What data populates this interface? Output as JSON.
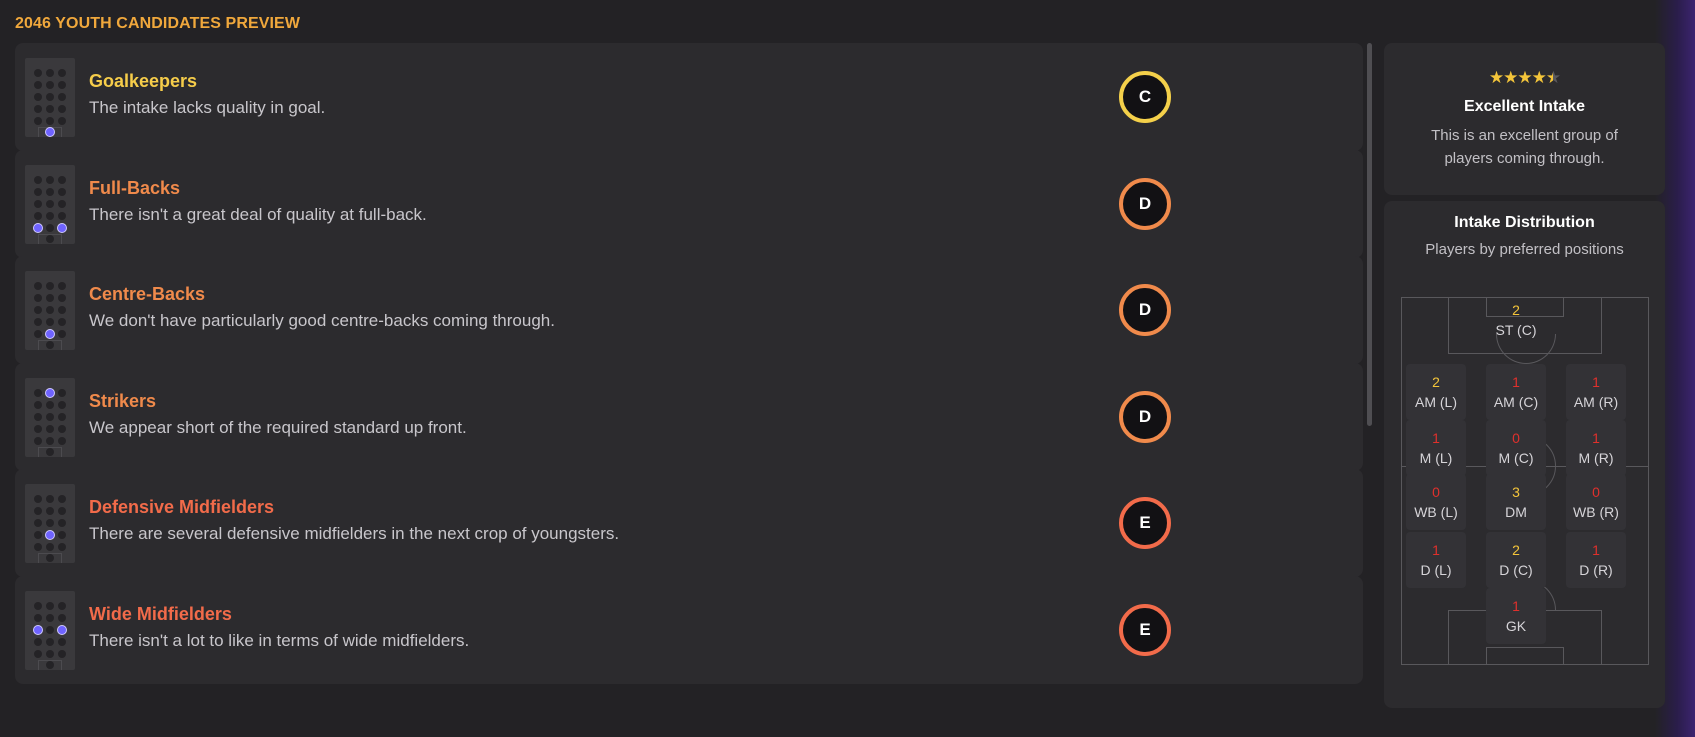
{
  "page": {
    "title": "2046 YOUTH CANDIDATES PREVIEW"
  },
  "colors": {
    "accent": "#f0a83c",
    "grade_c": "#f4d04a",
    "grade_d": "#f08a4b",
    "grade_e": "#f26b4a",
    "count_good": "#f4c53a",
    "count_poor": "#e0302c",
    "selected_dot": "#6f63ff"
  },
  "positions": [
    {
      "name": "Goalkeepers",
      "description": "The intake lacks quality in goal.",
      "grade": "C",
      "title_color": "#f6cd4a",
      "ring_color": "#f4d04a",
      "highlight_icon": "goalkeeper-position-icon"
    },
    {
      "name": "Full-Backs",
      "description": "There isn't a great deal of quality at full-back.",
      "grade": "D",
      "title_color": "#f08a4b",
      "ring_color": "#f08a4b",
      "highlight_icon": "full-back-position-icon"
    },
    {
      "name": "Centre-Backs",
      "description": "We don't have particularly good centre-backs coming through.",
      "grade": "D",
      "title_color": "#f08a4b",
      "ring_color": "#f08a4b",
      "highlight_icon": "centre-back-position-icon"
    },
    {
      "name": "Strikers",
      "description": "We appear short of the required standard up front.",
      "grade": "D",
      "title_color": "#f08a4b",
      "ring_color": "#f08a4b",
      "highlight_icon": "striker-position-icon"
    },
    {
      "name": "Defensive Midfielders",
      "description": "There are several defensive midfielders in the next crop of youngsters.",
      "grade": "E",
      "title_color": "#f26b4a",
      "ring_color": "#f26b4a",
      "highlight_icon": "defensive-midfielder-position-icon"
    },
    {
      "name": "Wide Midfielders",
      "description": "There isn't a lot to like in terms of wide midfielders.",
      "grade": "E",
      "title_color": "#f26b4a",
      "ring_color": "#f26b4a",
      "highlight_icon": "wide-midfielder-position-icon"
    }
  ],
  "summary": {
    "rating_stars": 4.5,
    "rating_max": 5,
    "title": "Excellent Intake",
    "text": "This is an excellent group of players coming through."
  },
  "distribution": {
    "title": "Intake Distribution",
    "subtitle": "Players by preferred positions",
    "cells": [
      {
        "label": "ST (C)",
        "count": "2"
      },
      {
        "label": "AM (L)",
        "count": "2"
      },
      {
        "label": "AM (C)",
        "count": "1"
      },
      {
        "label": "AM (R)",
        "count": "1"
      },
      {
        "label": "M (L)",
        "count": "1"
      },
      {
        "label": "M (C)",
        "count": "0"
      },
      {
        "label": "M (R)",
        "count": "1"
      },
      {
        "label": "WB (L)",
        "count": "0"
      },
      {
        "label": "DM",
        "count": "3"
      },
      {
        "label": "WB (R)",
        "count": "0"
      },
      {
        "label": "D (L)",
        "count": "1"
      },
      {
        "label": "D (C)",
        "count": "2"
      },
      {
        "label": "D (R)",
        "count": "1"
      },
      {
        "label": "GK",
        "count": "1"
      }
    ]
  }
}
